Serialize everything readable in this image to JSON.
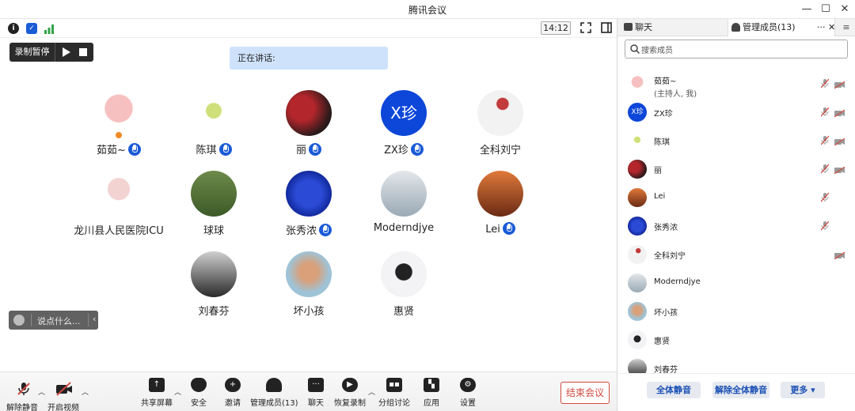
{
  "window": {
    "title": "腾讯会议",
    "minimize": "—",
    "maximize": "☐",
    "close": "✕"
  },
  "stage": {
    "time": "14:12",
    "record": {
      "label": "录制暂停"
    },
    "speaking_label": "正在讲话:",
    "chat_placeholder": "说点什么...",
    "participants": [
      {
        "name": "茹茹~",
        "mic": true,
        "host": true
      },
      {
        "name": "陈琪",
        "mic": true
      },
      {
        "name": "丽",
        "mic": true
      },
      {
        "name": "ZX珍",
        "mic": true,
        "avatar_text": "X珍"
      },
      {
        "name": "全科刘宁",
        "mic": false
      },
      {
        "name": "龙川县人民医院ICU",
        "mic": false
      },
      {
        "name": "球球",
        "mic": false
      },
      {
        "name": "张秀浓",
        "mic": true
      },
      {
        "name": "Moderndjye",
        "mic": false
      },
      {
        "name": "Lei",
        "mic": true
      },
      {
        "name": "刘春芬",
        "mic": false
      },
      {
        "name": "坏小孩",
        "mic": false
      },
      {
        "name": "惠贤",
        "mic": false
      }
    ]
  },
  "toolbar": {
    "unmute": "解除静音",
    "video": "开启视频",
    "share": "共享屏幕",
    "security": "安全",
    "invite": "邀请",
    "members": "管理成员(13)",
    "chat": "聊天",
    "record": "恢复录制",
    "breakout": "分组讨论",
    "apps": "应用",
    "settings": "设置",
    "end": "结束会议"
  },
  "panel": {
    "tab_chat": "聊天",
    "tab_members": "管理成员(13)",
    "search_placeholder": "搜索成员",
    "members": [
      {
        "name": "茹茹~",
        "sub": "(主持人, 我)",
        "mic_off": true,
        "cam_off": true
      },
      {
        "name": "ZX珍",
        "avatar_text": "X珍",
        "mic_off": true,
        "cam_off": true
      },
      {
        "name": "陈琪",
        "mic_off": true,
        "cam_off": true
      },
      {
        "name": "丽",
        "mic_off": true,
        "cam_off": true
      },
      {
        "name": "Lei",
        "mic_off": true,
        "cam_off": false
      },
      {
        "name": "张秀浓",
        "mic_off": true,
        "cam_off": false
      },
      {
        "name": "全科刘宁",
        "mic_off": false,
        "cam_off": true
      },
      {
        "name": "Moderndjye",
        "mic_off": false,
        "cam_off": false
      },
      {
        "name": "坏小孩",
        "mic_off": false,
        "cam_off": false
      },
      {
        "name": "惠贤",
        "mic_off": false,
        "cam_off": false
      },
      {
        "name": "刘春芬",
        "mic_off": false,
        "cam_off": false
      }
    ],
    "mute_all": "全体静音",
    "unmute_all": "解除全体静音",
    "more": "更多 ▾"
  },
  "colors": {
    "accent": "#1a5bd6",
    "end_red": "#d14a3f",
    "speaking_bg": "#cfe2fb"
  }
}
